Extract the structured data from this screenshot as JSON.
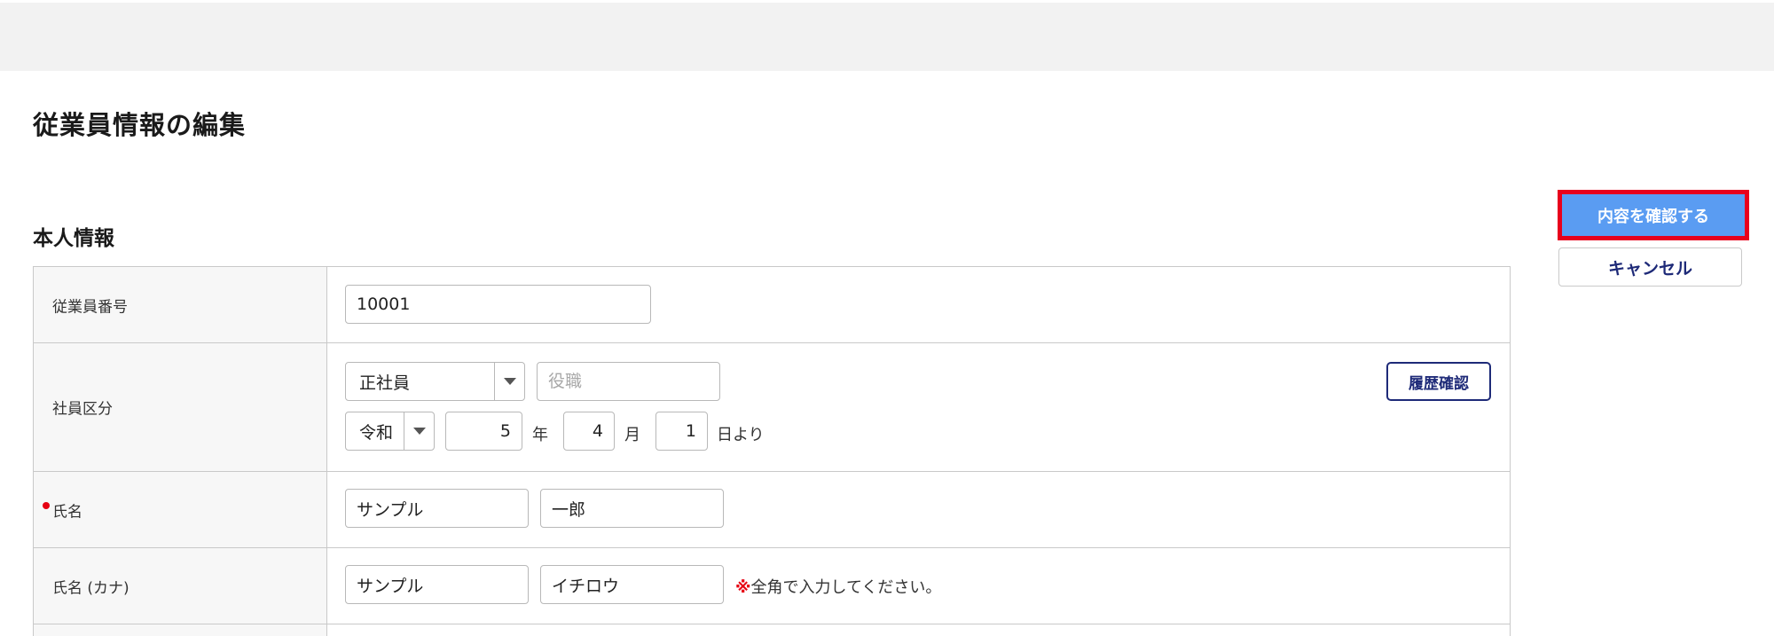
{
  "page": {
    "title": "従業員情報の編集",
    "section_title": "本人情報"
  },
  "actions": {
    "confirm_label": "内容を確認する",
    "cancel_label": "キャンセル"
  },
  "form": {
    "employee_number": {
      "label": "従業員番号",
      "value": "10001"
    },
    "employee_type": {
      "label": "社員区分",
      "type_value": "正社員",
      "position_placeholder": "役職",
      "history_button": "履歴確認",
      "era_value": "令和",
      "year_value": "5",
      "year_unit": "年",
      "month_value": "4",
      "month_unit": "月",
      "day_value": "1",
      "day_unit": "日より"
    },
    "name": {
      "label": "氏名",
      "last_value": "サンプル",
      "first_value": "一郎"
    },
    "name_kana": {
      "label": "氏名 (カナ)",
      "last_value": "サンプル",
      "first_value": "イチロウ",
      "note_mark": "※",
      "note_text": "全角で入力してください。"
    }
  },
  "colors": {
    "accent_button": "#5a9cf2",
    "highlight_border": "#e8001c",
    "navy_text": "#1e2a78",
    "required_dot": "#e60012"
  }
}
